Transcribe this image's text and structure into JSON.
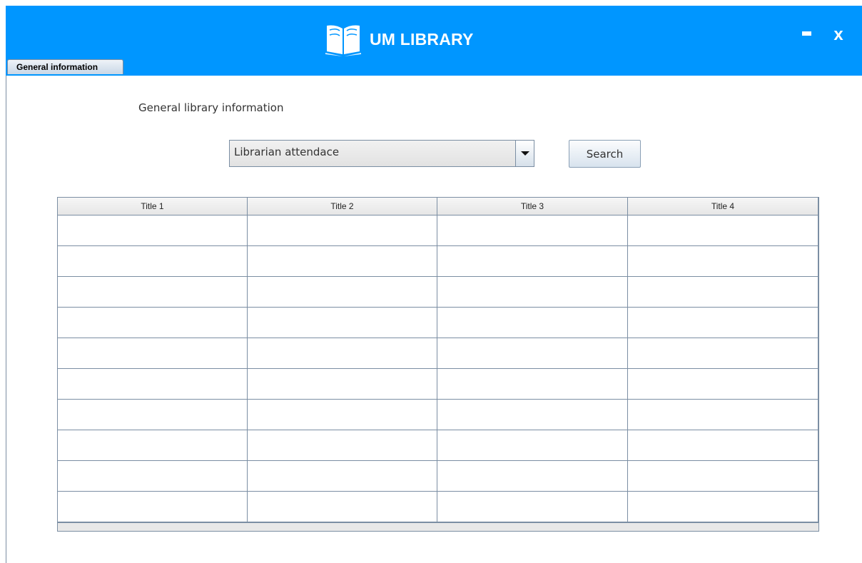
{
  "app": {
    "title": "UM LIBRARY",
    "minimize_label": "-",
    "close_label": "x",
    "accent_color": "#0096ff"
  },
  "tabs": [
    {
      "label": "General information",
      "active": true
    }
  ],
  "main": {
    "section_title": "General library information",
    "report_select": {
      "value": "Librarian attendace"
    },
    "search_label": "Search"
  },
  "table": {
    "columns": [
      "Title 1",
      "Title 2",
      "Title 3",
      "Title 4"
    ],
    "rows": [
      [
        "",
        "",
        "",
        ""
      ],
      [
        "",
        "",
        "",
        ""
      ],
      [
        "",
        "",
        "",
        ""
      ],
      [
        "",
        "",
        "",
        ""
      ],
      [
        "",
        "",
        "",
        ""
      ],
      [
        "",
        "",
        "",
        ""
      ],
      [
        "",
        "",
        "",
        ""
      ],
      [
        "",
        "",
        "",
        ""
      ],
      [
        "",
        "",
        "",
        ""
      ],
      [
        "",
        "",
        "",
        ""
      ]
    ]
  },
  "icons": {
    "logo": "open-book-icon",
    "dropdown": "caret-down-icon"
  }
}
